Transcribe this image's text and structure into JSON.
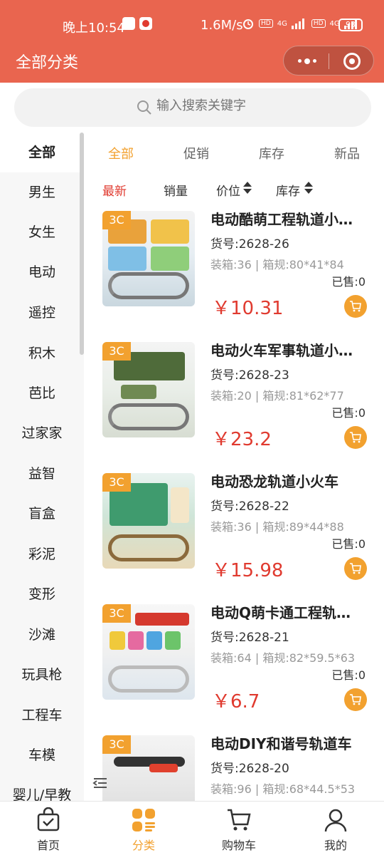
{
  "status_bar": {
    "time": "晚上10:54",
    "speed": "1.6M/s",
    "network1": "4G",
    "network2": "4G",
    "hd": "HD",
    "battery": "93"
  },
  "header": {
    "title": "全部分类"
  },
  "search": {
    "placeholder": "输入搜索关键字"
  },
  "sidebar": {
    "items": [
      {
        "label": "全部"
      },
      {
        "label": "男生"
      },
      {
        "label": "女生"
      },
      {
        "label": "电动"
      },
      {
        "label": "遥控"
      },
      {
        "label": "积木"
      },
      {
        "label": "芭比"
      },
      {
        "label": "过家家"
      },
      {
        "label": "益智"
      },
      {
        "label": "盲盒"
      },
      {
        "label": "彩泥"
      },
      {
        "label": "变形"
      },
      {
        "label": "沙滩"
      },
      {
        "label": "玩具枪"
      },
      {
        "label": "工程车"
      },
      {
        "label": "车模"
      },
      {
        "label": "婴儿/早教"
      }
    ]
  },
  "tabs": [
    {
      "label": "全部"
    },
    {
      "label": "促销"
    },
    {
      "label": "库存"
    },
    {
      "label": "新品"
    }
  ],
  "sort": [
    {
      "label": "最新"
    },
    {
      "label": "销量"
    },
    {
      "label": "价位"
    },
    {
      "label": "库存"
    }
  ],
  "products": [
    {
      "tag": "3C",
      "name": "电动酷萌工程轨道小火车",
      "code": "货号:2628-26",
      "spec": "装箱:36 | 箱规:80*41*84",
      "sold": "已售:0",
      "price": "￥10.31"
    },
    {
      "tag": "3C",
      "name": "电动火车军事轨道小火车",
      "code": "货号:2628-23",
      "spec": "装箱:20 | 箱规:81*62*77",
      "sold": "已售:0",
      "price": "￥23.2"
    },
    {
      "tag": "3C",
      "name": "电动恐龙轨道小火车",
      "code": "货号:2628-22",
      "spec": "装箱:36 | 箱规:89*44*88",
      "sold": "已售:0",
      "price": "￥15.98"
    },
    {
      "tag": "3C",
      "name": "电动Q萌卡通工程轨道车",
      "code": "货号:2628-21",
      "spec": "装箱:64 | 箱规:82*59.5*63",
      "sold": "已售:0",
      "price": "￥6.7"
    },
    {
      "tag": "3C",
      "name": "电动DIY和谐号轨道车",
      "code": "货号:2628-20",
      "spec": "装箱:96 | 箱规:68*44.5*53",
      "sold": "",
      "price": ""
    }
  ],
  "tabbar": [
    {
      "label": "首页",
      "icon": "home-bag-icon"
    },
    {
      "label": "分类",
      "icon": "category-icon"
    },
    {
      "label": "购物车",
      "icon": "cart-icon"
    },
    {
      "label": "我的",
      "icon": "profile-icon"
    }
  ],
  "colors": {
    "brand": "#e9654f",
    "accent": "#f2a12f",
    "price": "#e03a2f"
  }
}
